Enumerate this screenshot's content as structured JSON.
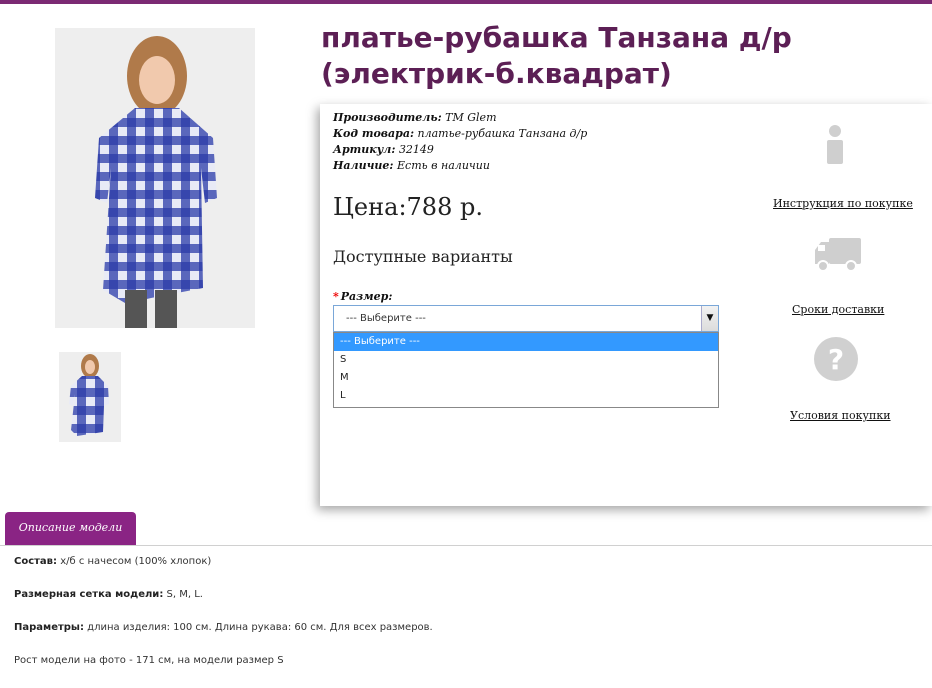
{
  "product": {
    "title": "платье-рубашка Танзана д/р (электрик-б.квадрат)",
    "manufacturer_key": "Производитель:",
    "manufacturer_val": "TM Glem",
    "code_key": "Код товара:",
    "code_val": "платье-рубашка Танзана д/р",
    "article_key": "Артикул:",
    "article_val": "32149",
    "availability_key": "Наличие:",
    "availability_val": "Есть в наличии",
    "price": "Цена:788 р.",
    "variants_heading": "Доступные варианты",
    "size_label": "Размер:",
    "size_required_mark": "*",
    "size_selected": "--- Выберите ---",
    "size_options": [
      "--- Выберите ---",
      "S",
      "M",
      "L"
    ]
  },
  "side_links": {
    "instruction": "Инструкция по покупке",
    "delivery": "Сроки доставки",
    "conditions": "Условия покупки"
  },
  "tabs": {
    "description": "Описание модели"
  },
  "description": {
    "composition_key": "Состав:",
    "composition_val": " х/б с начесом (100% хлопок)",
    "sizes_key": "Размерная сетка модели:",
    "sizes_val": " S, M, L.",
    "params_key": "Параметры:",
    "params_val": " длина изделия: 100 см. Длина рукава: 60 см. Для всех размеров.",
    "model_line": "Рост модели на фото - 171 см, на модели размер S"
  },
  "colors": {
    "accent": "#7b2a73",
    "title": "#5c1f55",
    "tab": "#8a2484",
    "dress_blue": "#2b3aa8",
    "selected_option": "#3399ff"
  },
  "icons": [
    "info-icon",
    "truck-icon",
    "question-icon",
    "dropdown-arrow-icon"
  ]
}
